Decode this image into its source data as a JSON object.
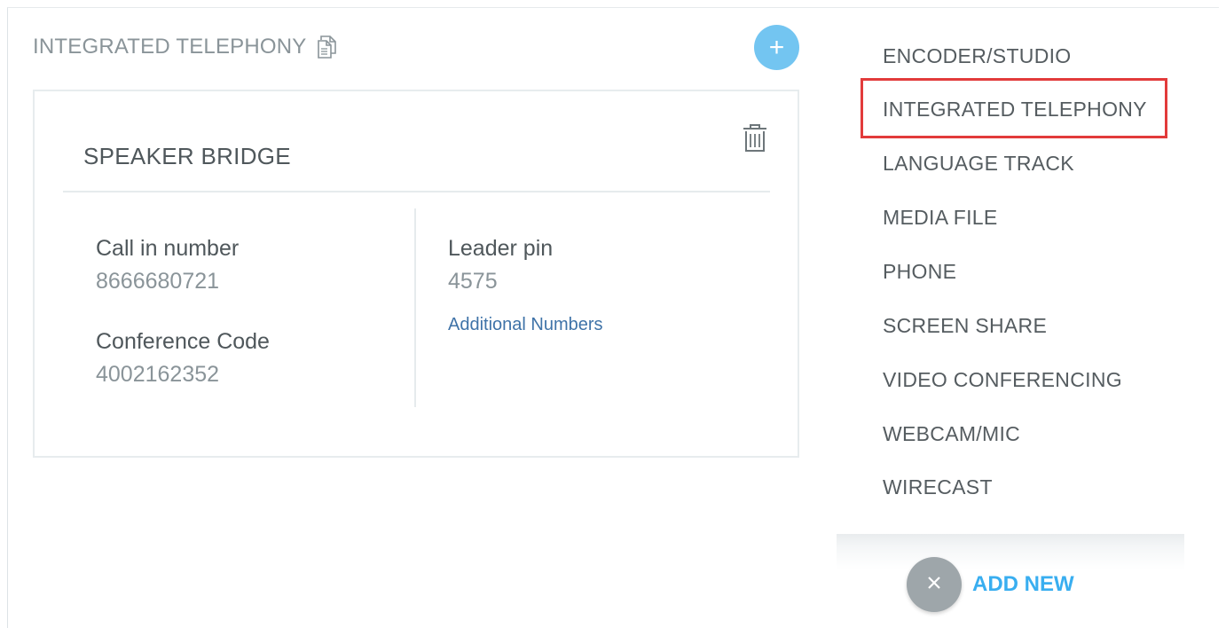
{
  "section": {
    "title": "INTEGRATED TELEPHONY",
    "add_symbol": "+"
  },
  "card": {
    "title": "SPEAKER BRIDGE",
    "fields": {
      "call_in_label": "Call in number",
      "call_in_value": "8666680721",
      "conference_label": "Conference Code",
      "conference_value": "4002162352",
      "leader_label": "Leader pin",
      "leader_value": "4575",
      "additional_link": "Additional Numbers"
    }
  },
  "dropdown": {
    "items": [
      {
        "label": "ENCODER/STUDIO"
      },
      {
        "label": "INTEGRATED TELEPHONY"
      },
      {
        "label": "LANGUAGE TRACK"
      },
      {
        "label": "MEDIA FILE"
      },
      {
        "label": "PHONE"
      },
      {
        "label": "SCREEN SHARE"
      },
      {
        "label": "VIDEO CONFERENCING"
      },
      {
        "label": "WEBCAM/MIC"
      },
      {
        "label": "WIRECAST"
      }
    ],
    "highlighted_item": "INTEGRATED TELEPHONY",
    "add_new_label": "ADD NEW"
  },
  "colors": {
    "accent": "#39aef0",
    "add_circle": "#73c5f1",
    "highlight": "#e23b3b",
    "link": "#3f73a8"
  },
  "icons": {
    "copy": "copy-icon",
    "trash": "trash-icon",
    "plus": "plus-icon",
    "close": "close-icon"
  }
}
